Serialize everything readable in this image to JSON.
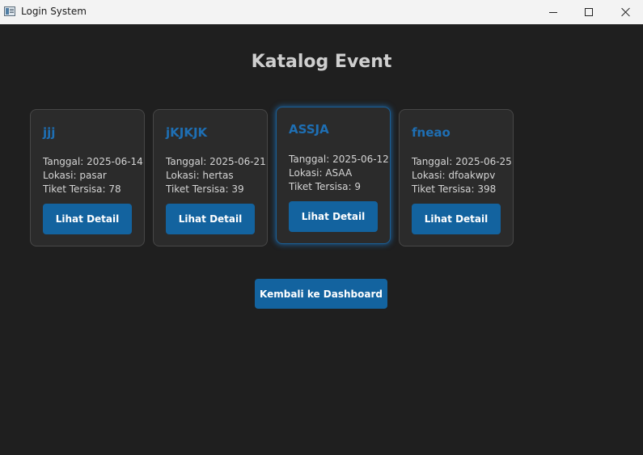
{
  "window": {
    "title": "Login System",
    "controls": [
      "minimize-icon",
      "maximize-icon",
      "close-icon"
    ]
  },
  "page": {
    "title": "Katalog Event"
  },
  "events": [
    {
      "name": "jjj",
      "date": "Tanggal: 2025-06-14",
      "location": "Lokasi: pasar",
      "tickets": "Tiket Tersisa: 78",
      "button": "Lihat Detail"
    },
    {
      "name": "jKJKJK",
      "date": "Tanggal: 2025-06-21",
      "location": "Lokasi: hertas",
      "tickets": "Tiket Tersisa: 39",
      "button": "Lihat Detail"
    },
    {
      "name": "ASSJA",
      "date": "Tanggal: 2025-06-12",
      "location": "Lokasi: ASAA",
      "tickets": "Tiket Tersisa: 9",
      "button": "Lihat Detail",
      "focused": true
    },
    {
      "name": "fneao",
      "date": "Tanggal: 2025-06-25",
      "location": "Lokasi: dfoakwpv",
      "tickets": "Tiket Tersisa: 398",
      "button": "Lihat Detail"
    }
  ],
  "actions": {
    "back_label": "Kembali ke Dashboard"
  },
  "colors": {
    "background": "#1f1f1f",
    "card": "#2b2b2b",
    "accent": "#13639f",
    "event_name": "#1e6fb4"
  }
}
